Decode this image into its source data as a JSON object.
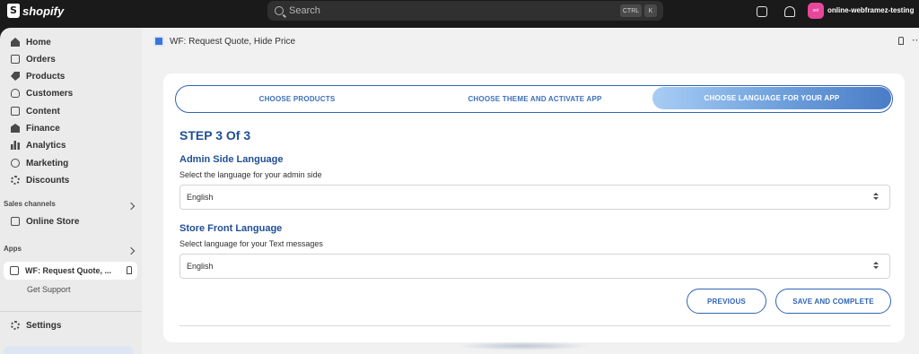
{
  "topbar": {
    "brand": "shopify",
    "search_placeholder": "Search",
    "shortcut_ctrl": "CTRL",
    "shortcut_k": "K",
    "avatar_initials": "onl",
    "store_name": "online-webframez-testing"
  },
  "sidebar": {
    "items": [
      {
        "label": "Home",
        "icon": "home-icon"
      },
      {
        "label": "Orders",
        "icon": "orders-icon"
      },
      {
        "label": "Products",
        "icon": "tag-icon"
      },
      {
        "label": "Customers",
        "icon": "person-icon"
      },
      {
        "label": "Content",
        "icon": "content-icon"
      },
      {
        "label": "Finance",
        "icon": "bank-icon"
      },
      {
        "label": "Analytics",
        "icon": "bar-chart-icon"
      },
      {
        "label": "Marketing",
        "icon": "target-icon"
      },
      {
        "label": "Discounts",
        "icon": "discount-icon"
      }
    ],
    "sales_channels_label": "Sales channels",
    "online_store_label": "Online Store",
    "apps_label": "Apps",
    "app_item_label": "WF: Request Quote, ...",
    "get_support_label": "Get Support",
    "settings_label": "Settings"
  },
  "header": {
    "title": "WF: Request Quote, Hide Price"
  },
  "stepper": {
    "steps": [
      {
        "label": "CHOOSE PRODUCTS",
        "active": false
      },
      {
        "label": "CHOOSE THEME AND ACTIVATE APP",
        "active": false
      },
      {
        "label": "CHOOSE LANGUAGE FOR YOUR APP",
        "active": true
      }
    ]
  },
  "form": {
    "step_heading": "STEP 3 Of 3",
    "admin_title": "Admin Side Language",
    "admin_sub": "Select the language for your admin side",
    "admin_value": "English",
    "store_title": "Store Front Language",
    "store_sub": "Select language for your Text messages",
    "store_value": "English",
    "previous_label": "PREVIOUS",
    "save_label": "SAVE AND COMPLETE"
  },
  "colors": {
    "accent": "#2f64b4",
    "heading": "#1f4e96",
    "avatar": "#e5479b"
  }
}
